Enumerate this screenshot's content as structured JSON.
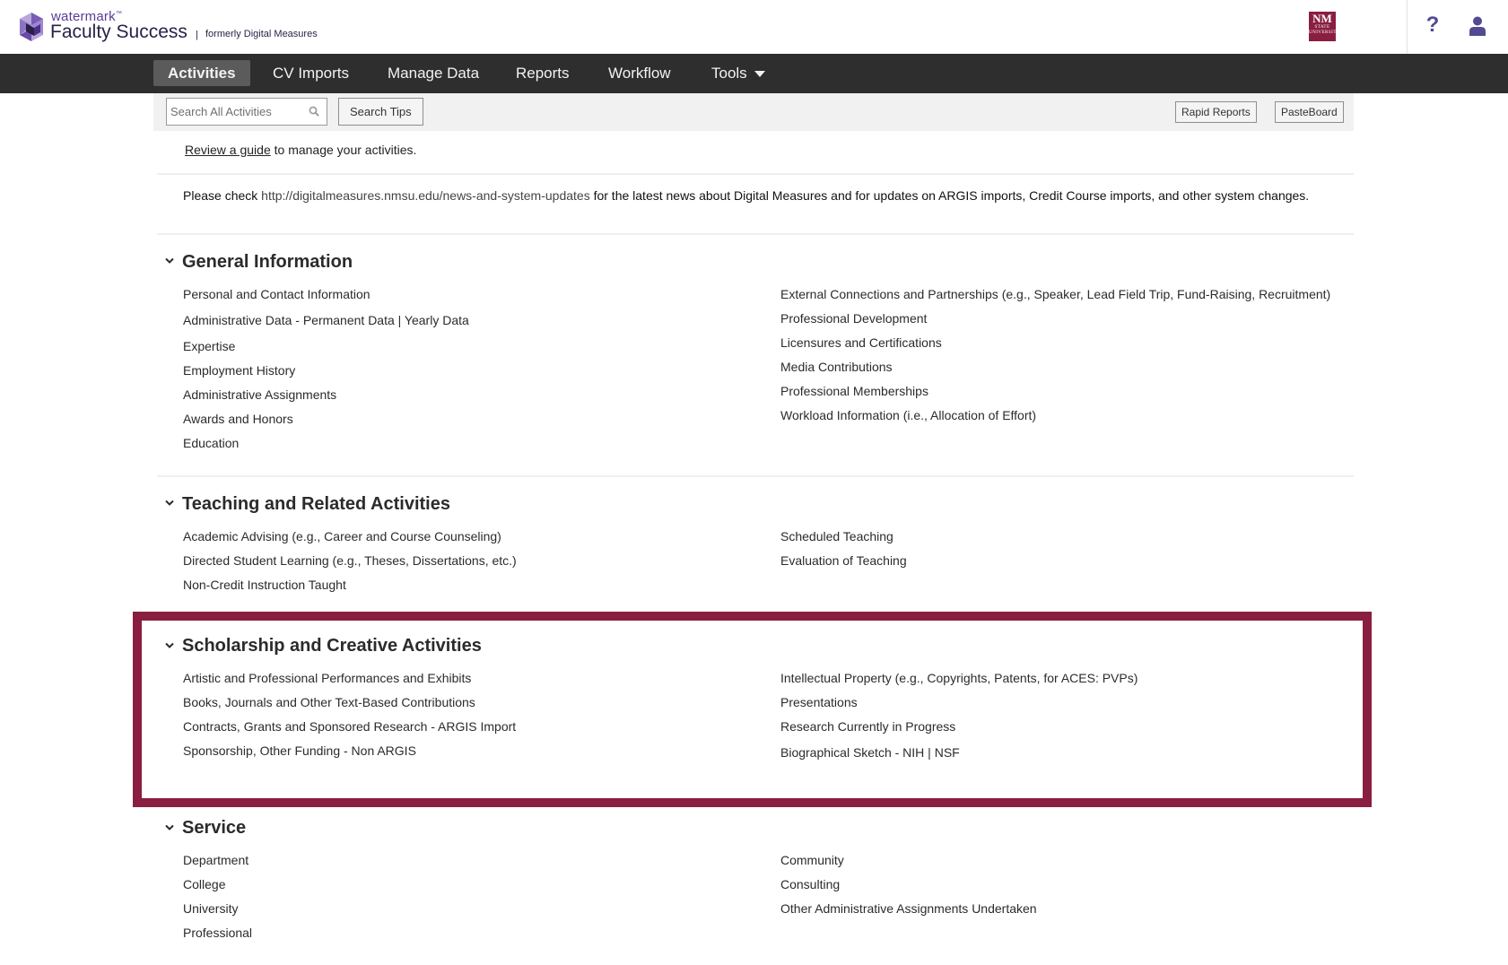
{
  "header": {
    "brand_top": "watermark",
    "brand_tm": "™",
    "brand_main": "Faculty Success",
    "brand_sep": "|",
    "brand_former": "formerly Digital Measures",
    "institution_logo": {
      "line1": "NM",
      "line2": "STATE",
      "line3": "UNIVERSITY"
    },
    "help_icon": "?",
    "colors": {
      "brand": "#5a3c96",
      "institution": "#8a1e41",
      "icons": "#524a93"
    }
  },
  "nav": {
    "items": [
      {
        "label": "Activities",
        "active": true
      },
      {
        "label": "CV Imports"
      },
      {
        "label": "Manage Data"
      },
      {
        "label": "Reports"
      },
      {
        "label": "Workflow"
      },
      {
        "label": "Tools",
        "has_dropdown": true
      }
    ]
  },
  "toolbar": {
    "search_placeholder": "Search All Activities",
    "search_value": "",
    "search_tips": "Search Tips",
    "rapid_reports": "Rapid Reports",
    "pasteboard": "PasteBoard"
  },
  "guide": {
    "link": "Review a guide",
    "text": " to manage your activities."
  },
  "news": {
    "prefix": "Please check ",
    "url": "http://digitalmeasures.nmsu.edu/news-and-system-updates",
    "suffix": " for the latest news about Digital Measures and for updates on ARGIS imports, Credit Course imports, and other system changes."
  },
  "sections": [
    {
      "title": "General Information",
      "left": [
        "Personal and Contact Information",
        "Administrative Data - Permanent Data | Yearly Data",
        "Expertise",
        "Employment History",
        "Administrative Assignments",
        "Awards and Honors",
        "Education"
      ],
      "right": [
        "External Connections and Partnerships (e.g., Speaker, Lead Field Trip, Fund-Raising, Recruitment)",
        "Professional Development",
        "Licensures and Certifications",
        "Media Contributions",
        "Professional Memberships",
        "Workload Information (i.e., Allocation of Effort)"
      ]
    },
    {
      "title": "Teaching and Related Activities",
      "left": [
        "Academic Advising (e.g., Career and Course Counseling)",
        "Directed Student Learning (e.g., Theses, Dissertations, etc.)",
        "Non-Credit Instruction Taught"
      ],
      "right": [
        "Scheduled Teaching",
        "Evaluation of Teaching"
      ]
    },
    {
      "title": "Scholarship and Creative Activities",
      "highlighted": true,
      "left": [
        "Artistic and Professional Performances and Exhibits",
        "Books, Journals and Other Text-Based Contributions",
        "Contracts, Grants and Sponsored Research - ARGIS Import",
        "Sponsorship, Other Funding - Non ARGIS"
      ],
      "right": [
        "Intellectual Property (e.g., Copyrights, Patents, for ACES: PVPs)",
        "Presentations",
        "Research Currently in Progress",
        "Biographical Sketch - NIH | NSF"
      ]
    },
    {
      "title": "Service",
      "left": [
        "Department",
        "College",
        "University",
        "Professional"
      ],
      "right": [
        "Community",
        "Consulting",
        "Other Administrative Assignments Undertaken"
      ]
    }
  ]
}
